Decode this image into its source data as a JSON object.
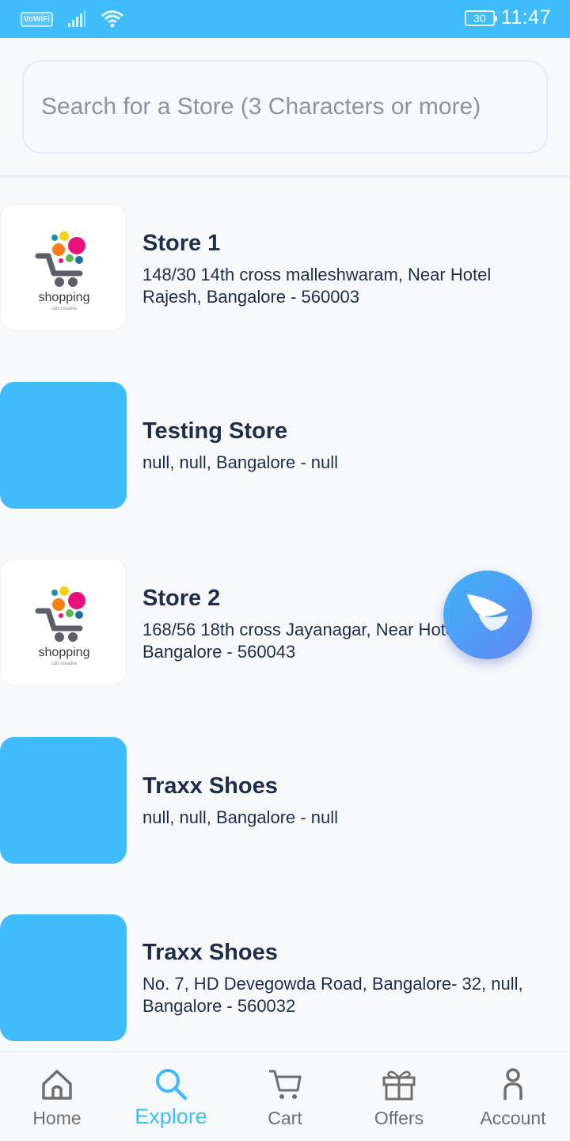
{
  "status_bar": {
    "network_badge": "VoWiFi",
    "battery": "30",
    "time": "11:47"
  },
  "search": {
    "placeholder": "Search for a Store (3 Characters or more)",
    "value": ""
  },
  "stores": [
    {
      "name": "Store 1",
      "address": "148/30 14th cross malleshwaram, Near Hotel Rajesh, Bangalore - 560003",
      "thumbnail": "shopping-logo",
      "logo_text": "shopping",
      "logo_subtext": "cart creative"
    },
    {
      "name": "Testing Store",
      "address": "null, null, Bangalore - null",
      "thumbnail": "placeholder"
    },
    {
      "name": "Store 2",
      "address": "168/56 18th cross Jayanagar, Near Hotel Kaju, Bangalore - 560043",
      "thumbnail": "shopping-logo",
      "logo_text": "shopping",
      "logo_subtext": "cart creative"
    },
    {
      "name": "Traxx Shoes",
      "address": "null, null, Bangalore - null",
      "thumbnail": "placeholder"
    },
    {
      "name": "Traxx Shoes",
      "address": "No. 7, HD Devegowda Road, Bangalore- 32, null, Bangalore - 560032",
      "thumbnail": "placeholder"
    }
  ],
  "nav": {
    "home": "Home",
    "explore": "Explore",
    "cart": "Cart",
    "offers": "Offers",
    "account": "Account",
    "active": "explore"
  },
  "colors": {
    "accent": "#3ebcfc",
    "text": "#1f2d4d",
    "inactive": "#6f6f6f",
    "background": "#f8f9fb"
  }
}
